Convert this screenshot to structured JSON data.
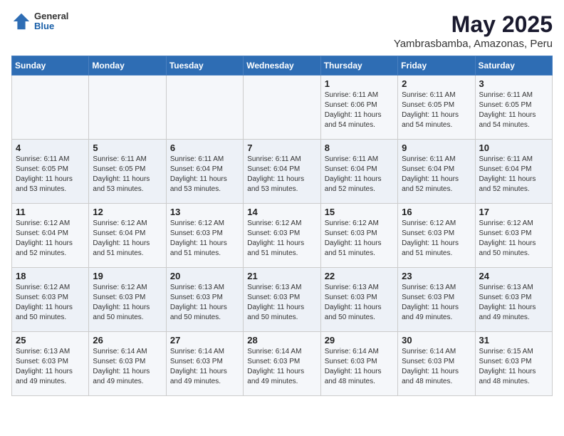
{
  "logo": {
    "general": "General",
    "blue": "Blue"
  },
  "title": "May 2025",
  "subtitle": "Yambrasbamba, Amazonas, Peru",
  "weekdays": [
    "Sunday",
    "Monday",
    "Tuesday",
    "Wednesday",
    "Thursday",
    "Friday",
    "Saturday"
  ],
  "weeks": [
    [
      {
        "day": "",
        "sunrise": "",
        "sunset": "",
        "daylight": ""
      },
      {
        "day": "",
        "sunrise": "",
        "sunset": "",
        "daylight": ""
      },
      {
        "day": "",
        "sunrise": "",
        "sunset": "",
        "daylight": ""
      },
      {
        "day": "",
        "sunrise": "",
        "sunset": "",
        "daylight": ""
      },
      {
        "day": "1",
        "sunrise": "Sunrise: 6:11 AM",
        "sunset": "Sunset: 6:06 PM",
        "daylight": "Daylight: 11 hours and 54 minutes."
      },
      {
        "day": "2",
        "sunrise": "Sunrise: 6:11 AM",
        "sunset": "Sunset: 6:05 PM",
        "daylight": "Daylight: 11 hours and 54 minutes."
      },
      {
        "day": "3",
        "sunrise": "Sunrise: 6:11 AM",
        "sunset": "Sunset: 6:05 PM",
        "daylight": "Daylight: 11 hours and 54 minutes."
      }
    ],
    [
      {
        "day": "4",
        "sunrise": "Sunrise: 6:11 AM",
        "sunset": "Sunset: 6:05 PM",
        "daylight": "Daylight: 11 hours and 53 minutes."
      },
      {
        "day": "5",
        "sunrise": "Sunrise: 6:11 AM",
        "sunset": "Sunset: 6:05 PM",
        "daylight": "Daylight: 11 hours and 53 minutes."
      },
      {
        "day": "6",
        "sunrise": "Sunrise: 6:11 AM",
        "sunset": "Sunset: 6:04 PM",
        "daylight": "Daylight: 11 hours and 53 minutes."
      },
      {
        "day": "7",
        "sunrise": "Sunrise: 6:11 AM",
        "sunset": "Sunset: 6:04 PM",
        "daylight": "Daylight: 11 hours and 53 minutes."
      },
      {
        "day": "8",
        "sunrise": "Sunrise: 6:11 AM",
        "sunset": "Sunset: 6:04 PM",
        "daylight": "Daylight: 11 hours and 52 minutes."
      },
      {
        "day": "9",
        "sunrise": "Sunrise: 6:11 AM",
        "sunset": "Sunset: 6:04 PM",
        "daylight": "Daylight: 11 hours and 52 minutes."
      },
      {
        "day": "10",
        "sunrise": "Sunrise: 6:11 AM",
        "sunset": "Sunset: 6:04 PM",
        "daylight": "Daylight: 11 hours and 52 minutes."
      }
    ],
    [
      {
        "day": "11",
        "sunrise": "Sunrise: 6:12 AM",
        "sunset": "Sunset: 6:04 PM",
        "daylight": "Daylight: 11 hours and 52 minutes."
      },
      {
        "day": "12",
        "sunrise": "Sunrise: 6:12 AM",
        "sunset": "Sunset: 6:04 PM",
        "daylight": "Daylight: 11 hours and 51 minutes."
      },
      {
        "day": "13",
        "sunrise": "Sunrise: 6:12 AM",
        "sunset": "Sunset: 6:03 PM",
        "daylight": "Daylight: 11 hours and 51 minutes."
      },
      {
        "day": "14",
        "sunrise": "Sunrise: 6:12 AM",
        "sunset": "Sunset: 6:03 PM",
        "daylight": "Daylight: 11 hours and 51 minutes."
      },
      {
        "day": "15",
        "sunrise": "Sunrise: 6:12 AM",
        "sunset": "Sunset: 6:03 PM",
        "daylight": "Daylight: 11 hours and 51 minutes."
      },
      {
        "day": "16",
        "sunrise": "Sunrise: 6:12 AM",
        "sunset": "Sunset: 6:03 PM",
        "daylight": "Daylight: 11 hours and 51 minutes."
      },
      {
        "day": "17",
        "sunrise": "Sunrise: 6:12 AM",
        "sunset": "Sunset: 6:03 PM",
        "daylight": "Daylight: 11 hours and 50 minutes."
      }
    ],
    [
      {
        "day": "18",
        "sunrise": "Sunrise: 6:12 AM",
        "sunset": "Sunset: 6:03 PM",
        "daylight": "Daylight: 11 hours and 50 minutes."
      },
      {
        "day": "19",
        "sunrise": "Sunrise: 6:12 AM",
        "sunset": "Sunset: 6:03 PM",
        "daylight": "Daylight: 11 hours and 50 minutes."
      },
      {
        "day": "20",
        "sunrise": "Sunrise: 6:13 AM",
        "sunset": "Sunset: 6:03 PM",
        "daylight": "Daylight: 11 hours and 50 minutes."
      },
      {
        "day": "21",
        "sunrise": "Sunrise: 6:13 AM",
        "sunset": "Sunset: 6:03 PM",
        "daylight": "Daylight: 11 hours and 50 minutes."
      },
      {
        "day": "22",
        "sunrise": "Sunrise: 6:13 AM",
        "sunset": "Sunset: 6:03 PM",
        "daylight": "Daylight: 11 hours and 50 minutes."
      },
      {
        "day": "23",
        "sunrise": "Sunrise: 6:13 AM",
        "sunset": "Sunset: 6:03 PM",
        "daylight": "Daylight: 11 hours and 49 minutes."
      },
      {
        "day": "24",
        "sunrise": "Sunrise: 6:13 AM",
        "sunset": "Sunset: 6:03 PM",
        "daylight": "Daylight: 11 hours and 49 minutes."
      }
    ],
    [
      {
        "day": "25",
        "sunrise": "Sunrise: 6:13 AM",
        "sunset": "Sunset: 6:03 PM",
        "daylight": "Daylight: 11 hours and 49 minutes."
      },
      {
        "day": "26",
        "sunrise": "Sunrise: 6:14 AM",
        "sunset": "Sunset: 6:03 PM",
        "daylight": "Daylight: 11 hours and 49 minutes."
      },
      {
        "day": "27",
        "sunrise": "Sunrise: 6:14 AM",
        "sunset": "Sunset: 6:03 PM",
        "daylight": "Daylight: 11 hours and 49 minutes."
      },
      {
        "day": "28",
        "sunrise": "Sunrise: 6:14 AM",
        "sunset": "Sunset: 6:03 PM",
        "daylight": "Daylight: 11 hours and 49 minutes."
      },
      {
        "day": "29",
        "sunrise": "Sunrise: 6:14 AM",
        "sunset": "Sunset: 6:03 PM",
        "daylight": "Daylight: 11 hours and 48 minutes."
      },
      {
        "day": "30",
        "sunrise": "Sunrise: 6:14 AM",
        "sunset": "Sunset: 6:03 PM",
        "daylight": "Daylight: 11 hours and 48 minutes."
      },
      {
        "day": "31",
        "sunrise": "Sunrise: 6:15 AM",
        "sunset": "Sunset: 6:03 PM",
        "daylight": "Daylight: 11 hours and 48 minutes."
      }
    ]
  ]
}
